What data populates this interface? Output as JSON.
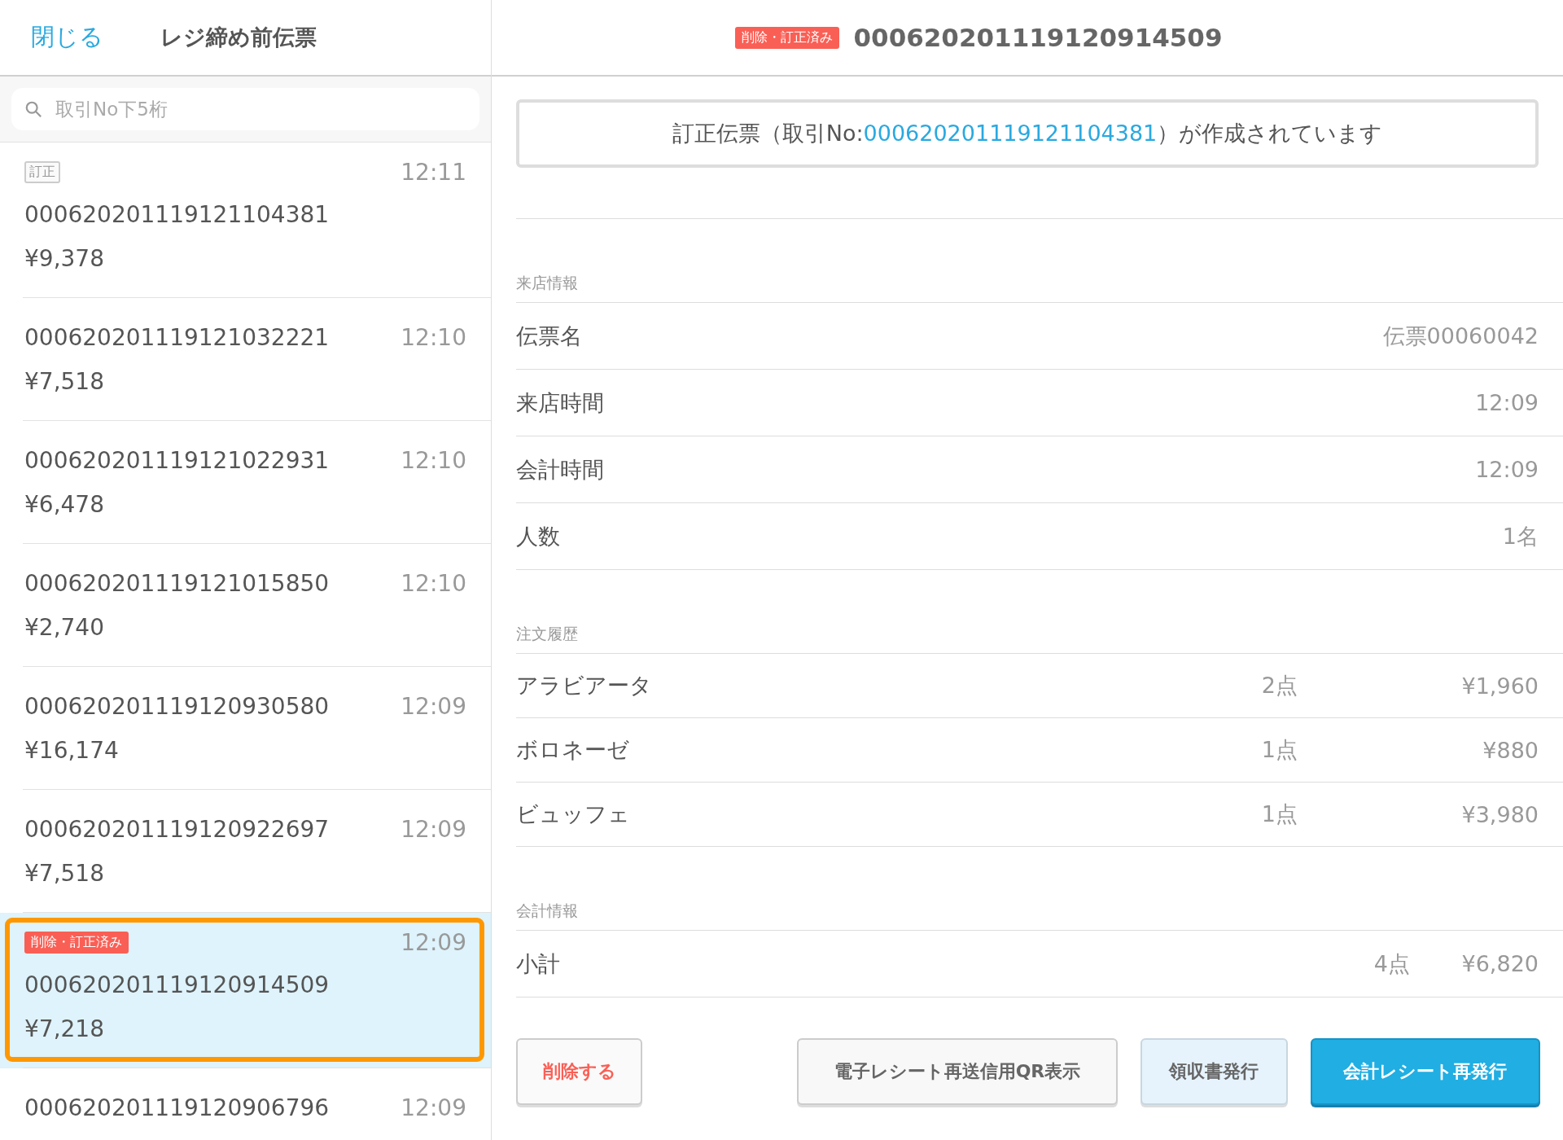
{
  "header": {
    "close": "閉じる",
    "title": "レジ締め前伝票"
  },
  "search": {
    "placeholder": "取引No下5桁"
  },
  "slips": [
    {
      "tag": {
        "kind": "correction",
        "label": "訂正"
      },
      "number": "000620201119121104381",
      "time": "12:11",
      "amount": "¥9,378",
      "selected": false,
      "highlighted": false
    },
    {
      "number": "000620201119121032221",
      "time": "12:10",
      "amount": "¥7,518",
      "selected": false,
      "highlighted": false
    },
    {
      "number": "000620201119121022931",
      "time": "12:10",
      "amount": "¥6,478",
      "selected": false,
      "highlighted": false
    },
    {
      "number": "000620201119121015850",
      "time": "12:10",
      "amount": "¥2,740",
      "selected": false,
      "highlighted": false
    },
    {
      "number": "000620201119120930580",
      "time": "12:09",
      "amount": "¥16,174",
      "selected": false,
      "highlighted": false
    },
    {
      "number": "000620201119120922697",
      "time": "12:09",
      "amount": "¥7,518",
      "selected": false,
      "highlighted": false
    },
    {
      "tag": {
        "kind": "deleted",
        "label": "削除・訂正済み"
      },
      "number": "000620201119120914509",
      "time": "12:09",
      "amount": "¥7,218",
      "selected": true,
      "highlighted": true
    },
    {
      "number": "000620201119120906796",
      "time": "12:09",
      "selected": false,
      "highlighted": false
    }
  ],
  "detail": {
    "tag": {
      "kind": "deleted",
      "label": "削除・訂正済み"
    },
    "number": "000620201119120914509",
    "notice": {
      "before": "訂正伝票（取引No:",
      "link": "000620201119121104381",
      "after": "）が作成されています"
    },
    "sections": [
      {
        "kind": "info",
        "title": "来店情報",
        "rows": [
          {
            "label": "伝票名",
            "value": "伝票00060042"
          },
          {
            "label": "来店時間",
            "value": "12:09"
          },
          {
            "label": "会計時間",
            "value": "12:09"
          },
          {
            "label": "人数",
            "value": "1名"
          }
        ]
      },
      {
        "kind": "orders",
        "title": "注文履歴",
        "rows": [
          {
            "label": "アラビアータ",
            "qty": "2点",
            "value": "¥1,960"
          },
          {
            "label": "ボロネーゼ",
            "qty": "1点",
            "value": "¥880"
          },
          {
            "label": "ビュッフェ",
            "qty": "1点",
            "value": "¥3,980"
          }
        ]
      },
      {
        "kind": "total",
        "title": "会計情報",
        "rows": [
          {
            "label": "小計",
            "qty": "4点",
            "value": "¥6,820"
          }
        ]
      }
    ]
  },
  "actions": [
    {
      "kind": "danger",
      "label": "削除する"
    },
    {
      "kind": "plain",
      "label": "電子レシート再送信用QR表示"
    },
    {
      "kind": "light",
      "label": "領収書発行"
    },
    {
      "kind": "primary",
      "label": "会計レシート再発行"
    }
  ]
}
